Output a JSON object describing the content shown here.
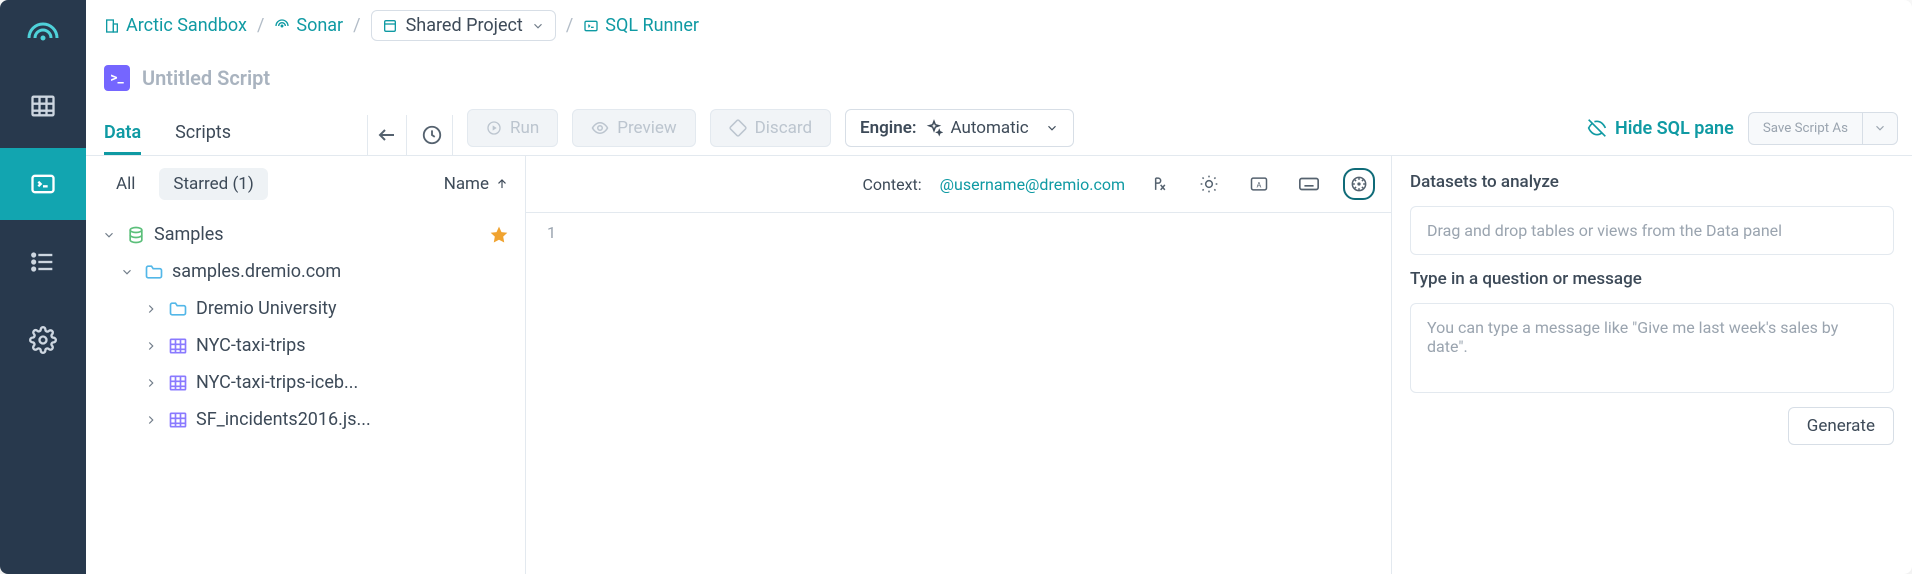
{
  "breadcrumbs": {
    "org": "Arctic Sandbox",
    "space": "Sonar",
    "project": "Shared Project",
    "page": "SQL Runner"
  },
  "script": {
    "title": "Untitled Script",
    "badge_glyph": ">_"
  },
  "tabs": {
    "data": "Data",
    "scripts": "Scripts"
  },
  "toolbar": {
    "run": "Run",
    "preview": "Preview",
    "discard": "Discard",
    "engine_label": "Engine:",
    "engine_value": "Automatic",
    "hide_sql": "Hide SQL pane",
    "save_as": "Save Script As"
  },
  "data_panel": {
    "filter_all": "All",
    "filter_starred": "Starred (1)",
    "sort_label": "Name",
    "items": [
      {
        "label": "Samples",
        "depth": 0,
        "icon": "db",
        "expanded": true,
        "starred": true
      },
      {
        "label": "samples.dremio.com",
        "depth": 1,
        "icon": "folder",
        "expanded": true
      },
      {
        "label": "Dremio University",
        "depth": 2,
        "icon": "folder",
        "expanded": false
      },
      {
        "label": "NYC-taxi-trips",
        "depth": 2,
        "icon": "table",
        "expanded": false
      },
      {
        "label": "NYC-taxi-trips-iceb...",
        "depth": 2,
        "icon": "table",
        "expanded": false
      },
      {
        "label": "SF_incidents2016.js...",
        "depth": 2,
        "icon": "table",
        "expanded": false
      }
    ]
  },
  "editor": {
    "context_label": "Context:",
    "context_value": "@username@dremio.com",
    "line_number": "1"
  },
  "assist": {
    "datasets_heading": "Datasets to analyze",
    "datasets_placeholder": "Drag and drop tables or views from the Data panel",
    "question_heading": "Type in a question or message",
    "question_placeholder": "You can type a message like \"Give me last week's sales by date\".",
    "generate": "Generate"
  }
}
